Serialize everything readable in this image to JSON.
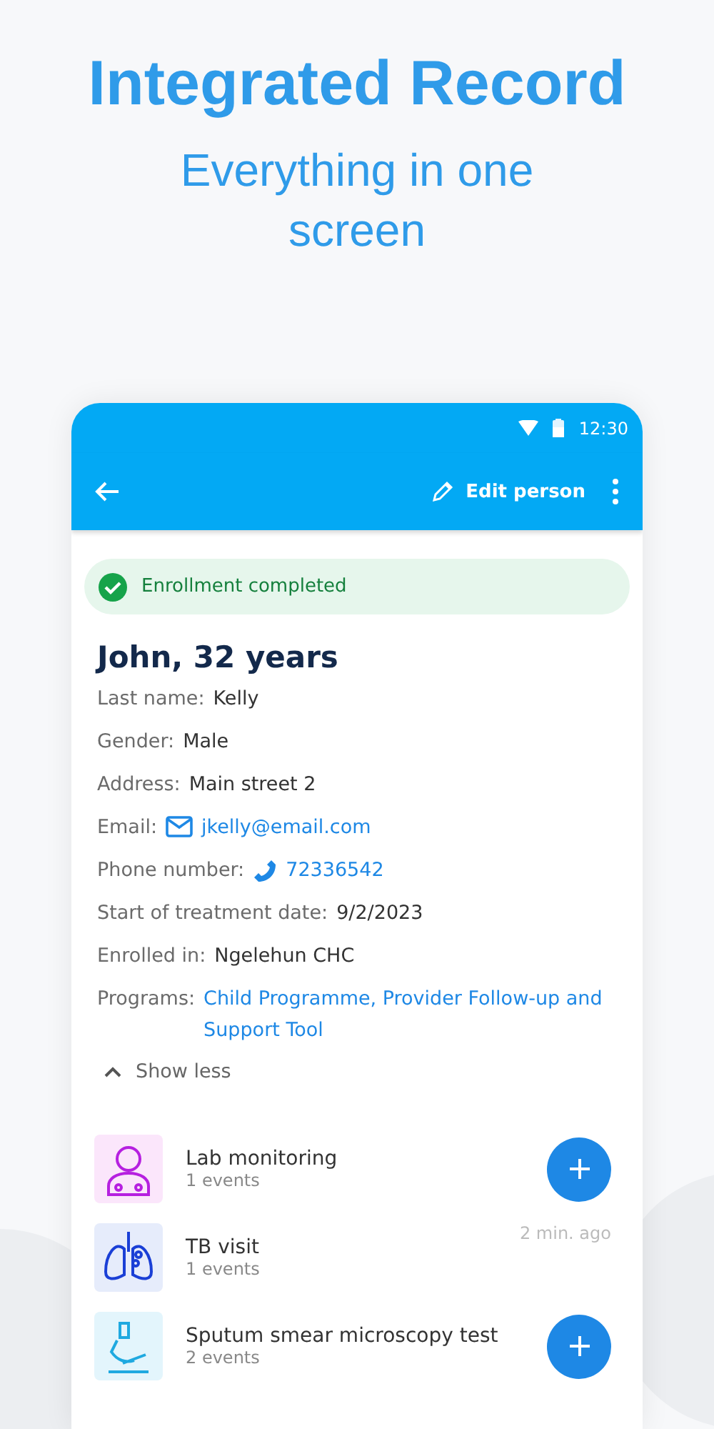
{
  "headline": "Integrated Record",
  "subheadline": "Everything in one screen",
  "status_bar": {
    "time": "12:30"
  },
  "toolbar": {
    "action": "Edit person"
  },
  "banner": {
    "text": "Enrollment completed"
  },
  "person": {
    "title": "John, 32 years",
    "fields": [
      {
        "label": "Last name:",
        "value": "Kelly",
        "kind": "plain"
      },
      {
        "label": "Gender:",
        "value": "Male",
        "kind": "plain"
      },
      {
        "label": "Address:",
        "value": "Main street 2",
        "kind": "plain"
      },
      {
        "label": "Email:",
        "value": "jkelly@email.com",
        "kind": "email"
      },
      {
        "label": "Phone number:",
        "value": "72336542",
        "kind": "phone"
      },
      {
        "label": "Start of treatment date:",
        "value": "9/2/2023",
        "kind": "plain"
      },
      {
        "label": "Enrolled in:",
        "value": "Ngelehun CHC",
        "kind": "plain"
      },
      {
        "label": "Programs:",
        "value": "Child Programme, Provider Follow-up and Support Tool",
        "kind": "link"
      }
    ],
    "toggle": "Show less"
  },
  "stages": [
    {
      "name": "Lab monitoring",
      "events": "1 events",
      "kind": "add",
      "color": "#b620e0"
    },
    {
      "name": "TB visit",
      "events": "1 events",
      "kind": "time",
      "time": "2 min. ago",
      "color": "#1a3fd6"
    },
    {
      "name": "Sputum smear microscopy test",
      "events": "2 events",
      "kind": "add",
      "color": "#1fa9e0"
    }
  ]
}
